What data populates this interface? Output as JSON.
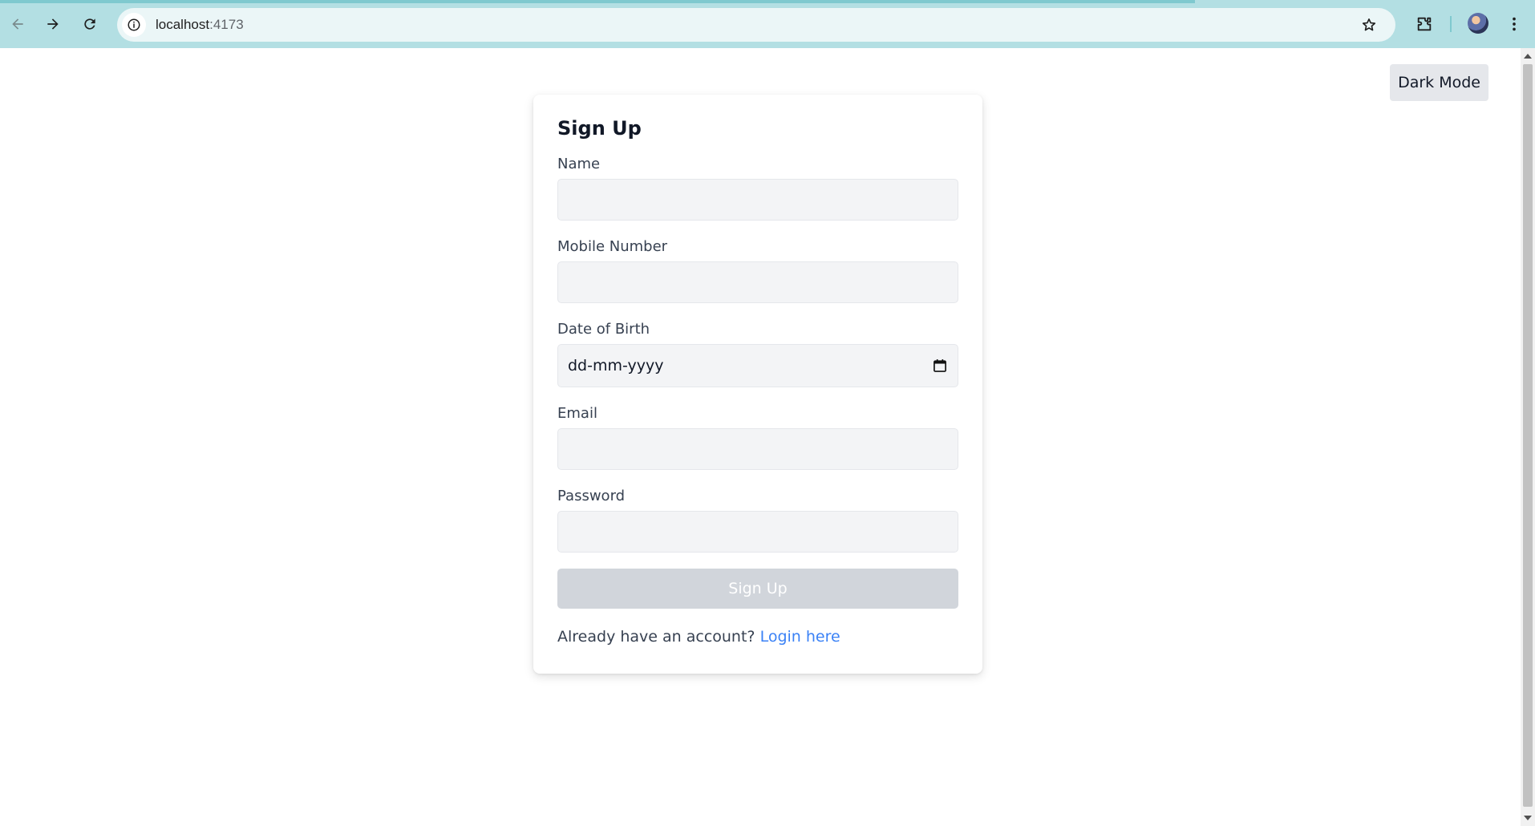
{
  "browser": {
    "url_host": "localhost",
    "url_port": ":4173"
  },
  "page": {
    "dark_mode_label": "Dark Mode"
  },
  "form": {
    "title": "Sign Up",
    "fields": {
      "name": {
        "label": "Name",
        "value": ""
      },
      "mobile": {
        "label": "Mobile Number",
        "value": ""
      },
      "dob": {
        "label": "Date of Birth",
        "value": "dd-mm-yyyy"
      },
      "email": {
        "label": "Email",
        "value": ""
      },
      "password": {
        "label": "Password",
        "value": ""
      }
    },
    "submit_label": "Sign Up",
    "footer_text": "Already have an account?",
    "login_link_label": "Login here"
  },
  "colors": {
    "chrome_bg": "#b3dfe3",
    "link": "#3b82f6",
    "button_disabled": "#d1d5db"
  }
}
